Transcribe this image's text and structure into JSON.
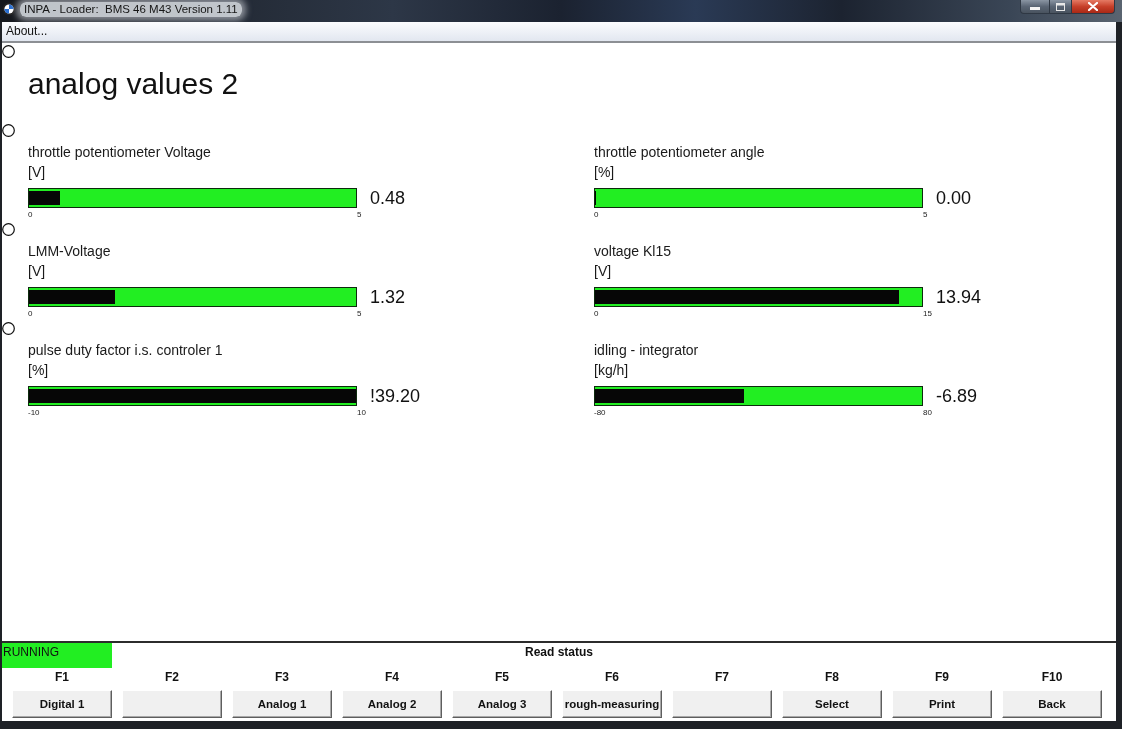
{
  "window": {
    "title": "INPA - Loader:  BMS 46 M43 Version 1.11"
  },
  "menu": [
    {
      "label": "About..."
    }
  ],
  "heading": "analog values 2",
  "rows": [
    {
      "gauges": [
        {
          "label": "throttle potentiometer Voltage",
          "unit": "[V]",
          "level": 0.096,
          "value": "0.48",
          "min": "0",
          "max": "5"
        },
        {
          "label": "throttle potentiometer angle",
          "unit": "[%]",
          "level": 0,
          "value": "0.00",
          "min": "0",
          "max": "5"
        }
      ]
    },
    {
      "gauges": [
        {
          "label": "LMM-Voltage",
          "unit": "[V]",
          "level": 0.264,
          "value": "1.32",
          "min": "0",
          "max": "5"
        },
        {
          "label": "voltage Kl15",
          "unit": "[V]",
          "level": 0.929,
          "value": "13.94",
          "min": "0",
          "max": "15"
        }
      ]
    },
    {
      "gauges": [
        {
          "label": "pulse duty factor i.s. controler 1",
          "unit": "[%]",
          "level": 1,
          "value": "!39.20",
          "min": "-10",
          "max": "10"
        },
        {
          "label": "idling - integrator",
          "unit": "[kg/h]",
          "level": 0.457,
          "value": "-6.89",
          "min": "-80",
          "max": "80"
        }
      ]
    }
  ],
  "status_bar": {
    "state": "RUNNING",
    "message": "Read status"
  },
  "function_keys": [
    {
      "key": "F1",
      "label": "Digital 1"
    },
    {
      "key": "F2"
    },
    {
      "key": "F3",
      "label": "Analog 1"
    },
    {
      "key": "F4",
      "label": "Analog 2"
    },
    {
      "key": "F5",
      "label": "Analog 3"
    },
    {
      "key": "F6",
      "label": "rough-measuring"
    },
    {
      "key": "F7"
    },
    {
      "key": "F8",
      "label": "Select"
    },
    {
      "key": "F9",
      "label": "Print"
    },
    {
      "key": "F10",
      "label": "Back"
    }
  ]
}
